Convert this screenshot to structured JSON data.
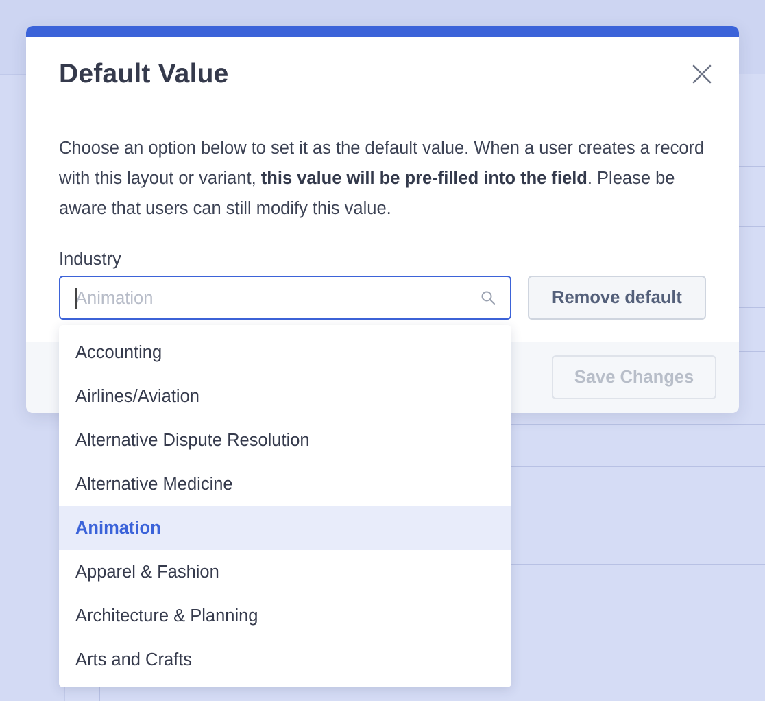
{
  "modal": {
    "title": "Default Value",
    "description_part1": "Choose an option below to set it as the default value. When a user creates a record with this layout or variant, ",
    "description_bold": "this value will be pre-filled into the field",
    "description_part2": ". Please be aware that users can still modify this value.",
    "field_label": "Industry",
    "search": {
      "value": "",
      "placeholder": "Animation"
    },
    "remove_default_label": "Remove default",
    "save_changes_label": "Save Changes"
  },
  "dropdown": {
    "options": [
      "Accounting",
      "Airlines/Aviation",
      "Alternative Dispute Resolution",
      "Alternative Medicine",
      "Animation",
      "Apparel & Fashion",
      "Architecture & Planning",
      "Arts and Crafts"
    ],
    "highlighted": "Animation"
  },
  "colors": {
    "accent": "#3b63d9",
    "highlight_bg": "#e8ecfa",
    "backdrop": "#d3daf4"
  },
  "icons": {
    "close": "close-icon",
    "search": "search-icon"
  }
}
